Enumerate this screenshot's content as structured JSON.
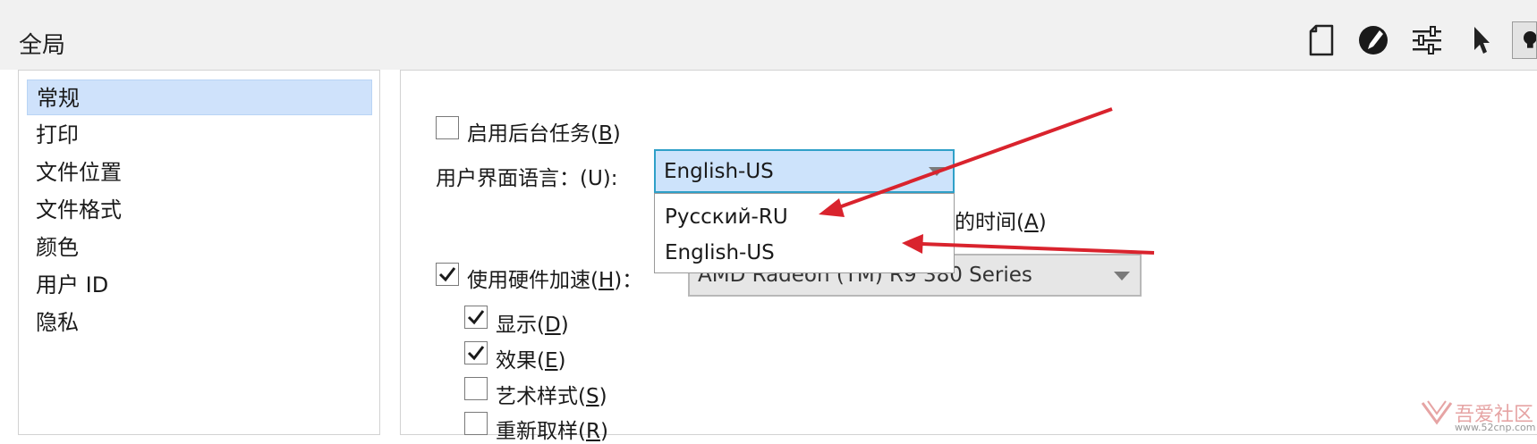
{
  "header": {
    "title": "全局",
    "toolbar_icons": [
      "document-icon",
      "color-palette-icon",
      "sliders-icon",
      "pointer-icon",
      "lightbulb-icon"
    ]
  },
  "sidebar": {
    "items": [
      {
        "label": "常规",
        "selected": true
      },
      {
        "label": "打印",
        "selected": false
      },
      {
        "label": "文件位置",
        "selected": false
      },
      {
        "label": "文件格式",
        "selected": false
      },
      {
        "label": "颜色",
        "selected": false
      },
      {
        "label": "用户 ID",
        "selected": false
      },
      {
        "label": "隐私",
        "selected": false
      }
    ]
  },
  "content": {
    "background_tasks": {
      "label": "启用后台任务(",
      "mnemonic": "B",
      "suffix": ")",
      "checked": false
    },
    "ui_language": {
      "label": "用户界面语言：(U):",
      "value": "English-US",
      "options": [
        "Русский-RU",
        "English-US"
      ]
    },
    "hidden_option_label": {
      "text": "的时间(",
      "mnemonic": "A",
      "suffix": ")"
    },
    "hardware_accel": {
      "label": "使用硬件加速(",
      "mnemonic": "H",
      "suffix": ")：",
      "checked": true,
      "device": "AMD Radeon (TM) R9 380 Series"
    },
    "sub_options": [
      {
        "label": "显示(",
        "mnemonic": "D",
        "suffix": ")",
        "checked": true
      },
      {
        "label": "效果(",
        "mnemonic": "E",
        "suffix": ")",
        "checked": true
      },
      {
        "label": "艺术样式(",
        "mnemonic": "S",
        "suffix": ")",
        "checked": false
      },
      {
        "label": "重新取样(",
        "mnemonic": "R",
        "suffix": ")",
        "checked": false
      }
    ]
  },
  "watermark": {
    "text": "吾爱社区",
    "url": "www.52cnp.com"
  },
  "colors": {
    "selection": "#cfe2fb",
    "focus_border": "#2fa0c8",
    "annotation_arrow": "#d9232d"
  }
}
